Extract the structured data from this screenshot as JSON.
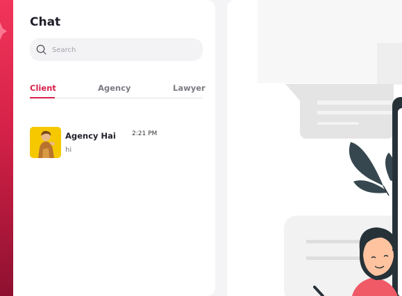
{
  "chat": {
    "title": "Chat",
    "search": {
      "placeholder": "Search",
      "value": ""
    },
    "tabs": [
      {
        "label": "Client",
        "active": true
      },
      {
        "label": "Agency",
        "active": false
      },
      {
        "label": "Lawyer",
        "active": false
      }
    ],
    "conversations": [
      {
        "name": "Agency Hai",
        "time": "2:21 PM",
        "last_message": "hi",
        "avatar": "profile-photo"
      }
    ]
  },
  "colors": {
    "accent": "#d81f4a",
    "rail_top": "#f2355a",
    "rail_bottom": "#8e1030",
    "avatar_bg": "#f5c800",
    "illustration_dark": "#263238"
  },
  "illustration": "empty-chat-illustration"
}
